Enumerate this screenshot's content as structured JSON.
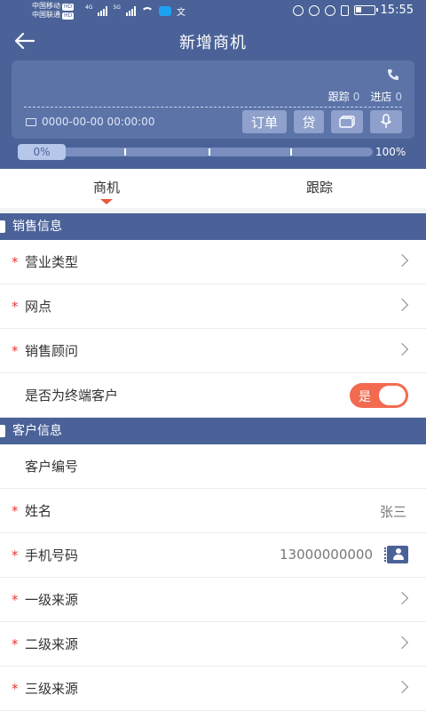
{
  "status_bar": {
    "carrier1": "中国移动",
    "carrier2": "中国联通",
    "hd": "HD",
    "net1": "4G",
    "net2": "5G",
    "time": "15:55"
  },
  "header": {
    "title": "新增商机"
  },
  "card": {
    "follow_label": "跟踪",
    "follow_count": "0",
    "visit_label": "进店",
    "visit_count": "0",
    "datetime": "0000-00-00 00:00:00",
    "btn_order": "订单",
    "btn_loan": "贷"
  },
  "progress": {
    "value_percent": 0,
    "start_label": "0%",
    "end_label": "100%"
  },
  "tabs": [
    {
      "label": "商机",
      "active": true
    },
    {
      "label": "跟踪",
      "active": false
    }
  ],
  "sales_section": {
    "title": "销售信息",
    "rows": [
      {
        "label": "营业类型",
        "required": "*"
      },
      {
        "label": "网点",
        "required": "*"
      },
      {
        "label": "销售顾问",
        "required": "*"
      }
    ],
    "terminal_customer": {
      "label": "是否为终端客户",
      "toggle_text": "是",
      "value": true
    }
  },
  "customer_section": {
    "title": "客户信息",
    "customer_no_label": "客户编号",
    "name": {
      "label": "姓名",
      "required": "*",
      "value": "张三"
    },
    "phone": {
      "label": "手机号码",
      "required": "*",
      "value": "13000000000"
    },
    "sources": [
      {
        "label": "一级来源",
        "required": "*"
      },
      {
        "label": "二级来源",
        "required": "*"
      },
      {
        "label": "三级来源",
        "required": "*"
      }
    ]
  },
  "colors": {
    "primary": "#4a6298",
    "accent": "#f26b50",
    "required": "#e53935"
  }
}
